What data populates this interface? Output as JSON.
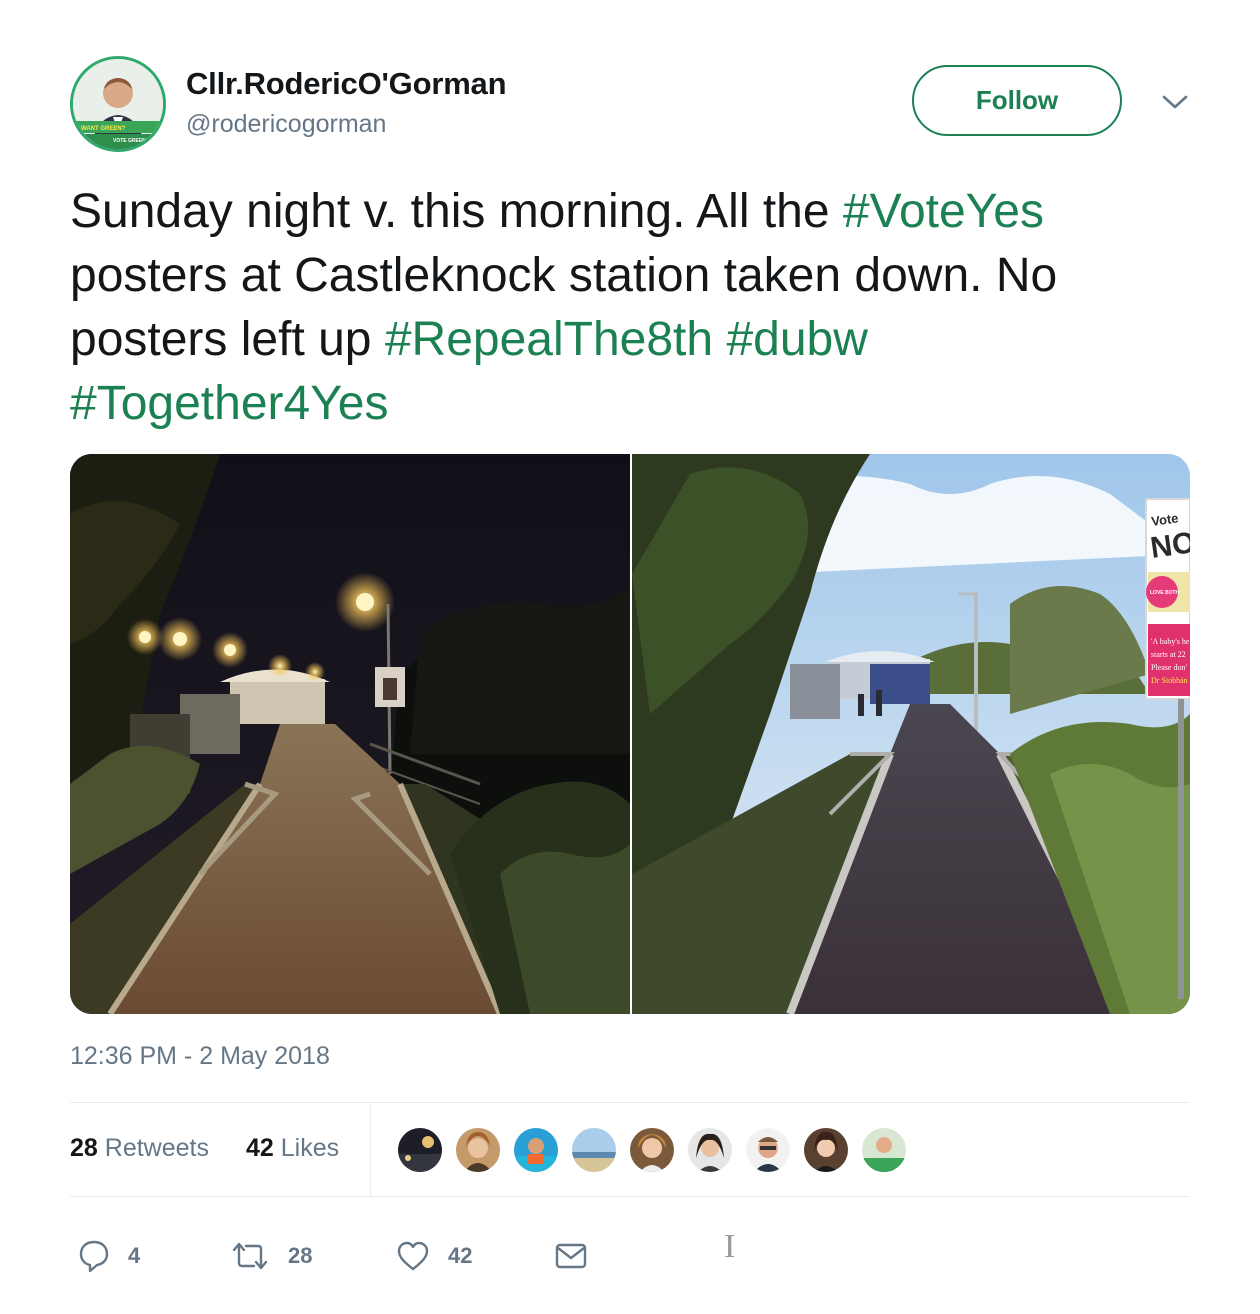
{
  "user": {
    "display_name": "Cllr.RodericO'Gorman",
    "handle": "@rodericogorman",
    "avatar_caption": [
      "WANT GREEN?",
      "VOTE GREEN"
    ]
  },
  "follow_button": {
    "label": "Follow"
  },
  "tweet": {
    "text_parts": {
      "p1": "Sunday night v. this morning. All the ",
      "h1": "#VoteYes",
      "p2": " posters at Castleknock station taken down. No posters left up ",
      "h2": "#RepealThe8th",
      "p3": " ",
      "h3": "#dubw",
      "p4": " ",
      "h4": "#Together4Yes"
    },
    "hashtag_color": "#1b8153"
  },
  "media": {
    "right_poster": {
      "line1": "Vote",
      "line2": "NO",
      "line3": "LOVE BOTH",
      "lines": [
        "'A baby's he",
        "starts at 22",
        "Please don'",
        "Dr Siobhán C"
      ]
    }
  },
  "timestamp": "12:36 PM - 2 May 2018",
  "stats": {
    "retweets_count": "28",
    "retweets_label": "Retweets",
    "likes_count": "42",
    "likes_label": "Likes"
  },
  "actions": {
    "reply_count": "4",
    "retweet_count": "28",
    "like_count": "42"
  },
  "colors": {
    "accent": "#1b8153",
    "muted": "#657786",
    "divider": "#e6ecf0"
  }
}
